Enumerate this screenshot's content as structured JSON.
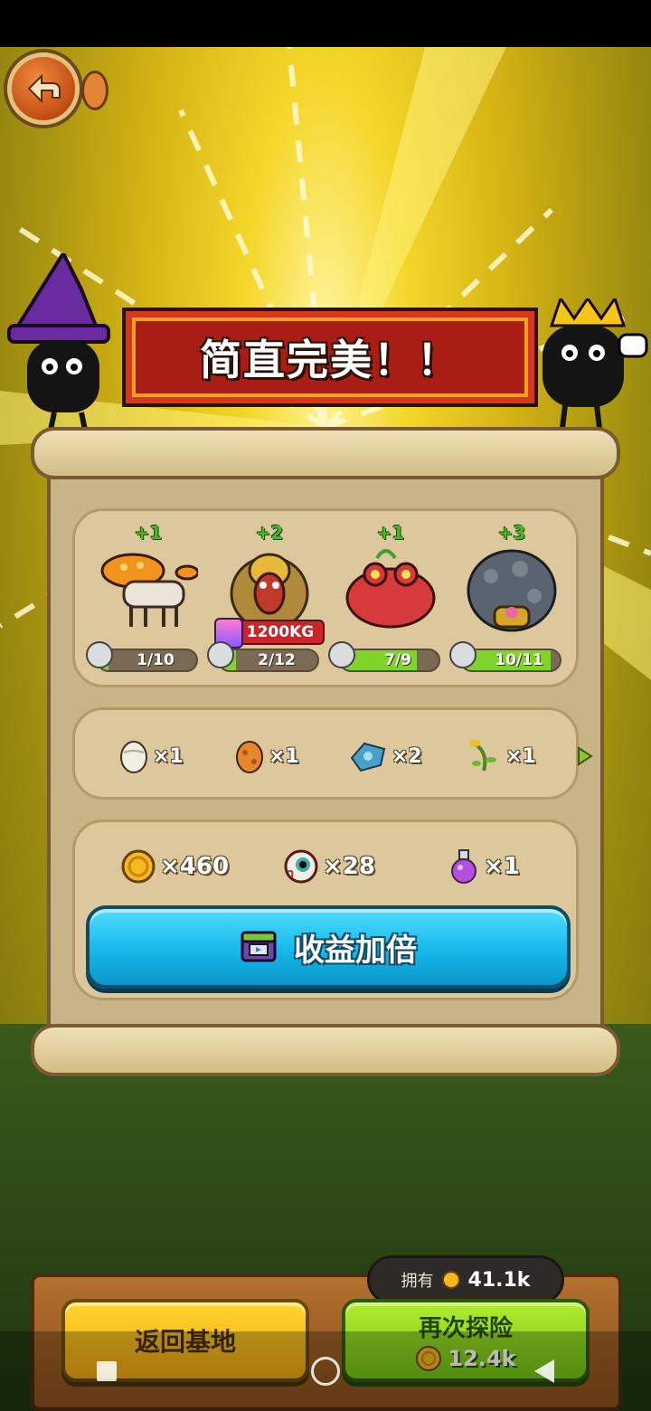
{
  "banner": {
    "title": "简直完美！！"
  },
  "monsters": [
    {
      "name_icon": "mushroom-creature-icon",
      "bonus": "+1",
      "progress": "1/10",
      "fill_fraction": 0.1
    },
    {
      "name_icon": "plant-ape-icon",
      "bonus": "+2",
      "progress": "2/12",
      "fill_fraction": 0.17,
      "weight": "1200KG",
      "weight_icon": "KG"
    },
    {
      "name_icon": "red-frog-icon",
      "bonus": "+1",
      "progress": "7/9",
      "fill_fraction": 0.78
    },
    {
      "name_icon": "rock-golem-icon",
      "bonus": "+3",
      "progress": "10/11",
      "fill_fraction": 0.91
    }
  ],
  "items": [
    {
      "icon": "white-egg-icon",
      "qty": "×1"
    },
    {
      "icon": "orange-egg-icon",
      "qty": "×1"
    },
    {
      "icon": "blue-gem-icon",
      "qty": "×2"
    },
    {
      "icon": "vine-herb-icon",
      "qty": "×1"
    }
  ],
  "rewards": [
    {
      "icon": "coin-icon",
      "qty": "×460"
    },
    {
      "icon": "eyeball-icon",
      "qty": "×28"
    },
    {
      "icon": "potion-icon",
      "qty": "×1"
    }
  ],
  "double_button": {
    "label": "收益加倍"
  },
  "owned": {
    "label": "拥有",
    "value": "41.1k"
  },
  "return_button": {
    "label": "返回基地"
  },
  "again_button": {
    "label": "再次探险",
    "cost": "12.4k"
  },
  "colors": {
    "accent_green": "#7fd42a",
    "accent_blue": "#16b8ea",
    "banner_red": "#a81d14"
  }
}
